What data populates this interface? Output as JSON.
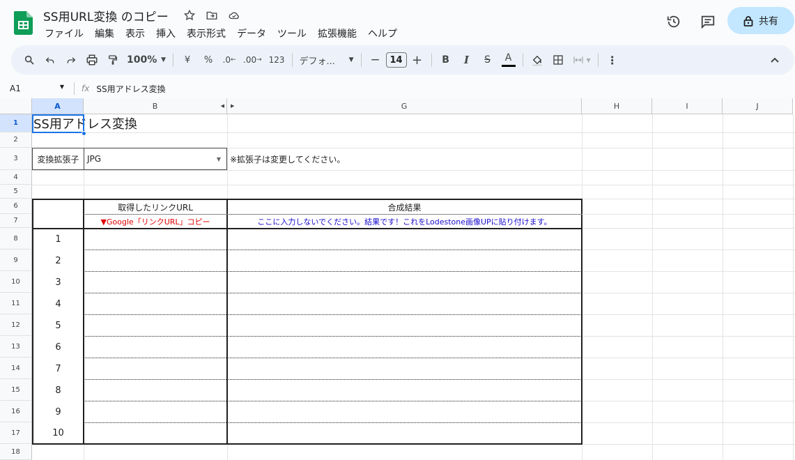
{
  "doc": {
    "title": "SS用URL変換 のコピー",
    "share_label": "共有"
  },
  "menu": [
    "ファイル",
    "編集",
    "表示",
    "挿入",
    "表示形式",
    "データ",
    "ツール",
    "拡張機能",
    "ヘルプ"
  ],
  "toolbar": {
    "zoom": "100%",
    "currency": "¥",
    "percent": "%",
    "dec_dec": ".0",
    "dec_inc": ".00",
    "format_123": "123",
    "font": "デフォ...",
    "font_size": "14",
    "minus": "−",
    "plus": "+",
    "bold": "B",
    "italic": "I",
    "strike": "S",
    "text_color": "A"
  },
  "formula_bar": {
    "cell_ref": "A1",
    "fx": "fx",
    "content": "SS用アドレス変換"
  },
  "columns": [
    "A",
    "B",
    "G",
    "H",
    "I",
    "J"
  ],
  "rows": [
    "1",
    "2",
    "3",
    "4",
    "5",
    "6",
    "7",
    "8",
    "9",
    "10",
    "11",
    "12",
    "13",
    "14",
    "15",
    "16",
    "17",
    "18"
  ],
  "sheet": {
    "title": "SS用アドレス変換",
    "ext_label": "変換拡張子",
    "ext_value": "JPG",
    "ext_note": "※拡張子は変更してください。",
    "header_link": "取得したリンクURL",
    "header_result": "合成結果",
    "sub_link": "▼Google「リンクURL」コピー",
    "sub_result": "ここに入力しないでください。結果です！これをLodestone画像UPに貼り付けます。",
    "numbers": [
      "1",
      "2",
      "3",
      "4",
      "5",
      "6",
      "7",
      "8",
      "9",
      "10"
    ]
  },
  "colors": {
    "accent": "#0b57d0",
    "share_bg": "#c2e7ff",
    "red_text": "#e00000",
    "blue_text": "#1a0dcc"
  }
}
